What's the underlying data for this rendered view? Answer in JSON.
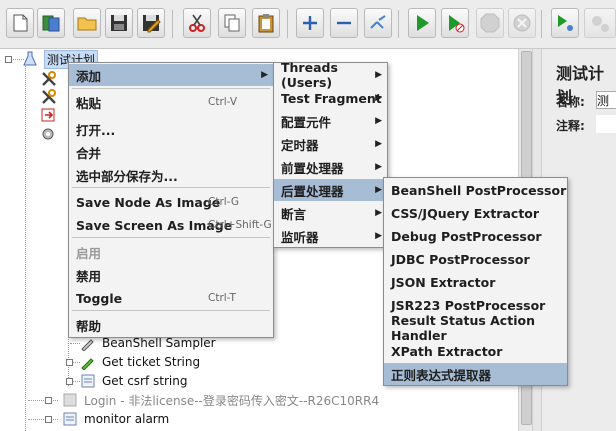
{
  "tree": {
    "root": "测试计划",
    "items": {
      "beanshell": "BeanShell Sampler",
      "get_ticket": "Get  ticket  String",
      "get_csrf": "Get csrf  string",
      "login": "Login - 非法license--登录密码传入密文--R26C10RR4",
      "monitor": "monitor alarm"
    }
  },
  "right_panel": {
    "title": "测试计划",
    "name_label": "名称:",
    "name_value": "测",
    "comment_label": "注释:"
  },
  "context_menu": {
    "items": [
      {
        "label": "添加",
        "shortcut": "",
        "submenu": true,
        "selected": true,
        "disabled": false
      },
      {
        "label": "粘贴",
        "shortcut": "Ctrl-V",
        "submenu": false,
        "selected": false,
        "disabled": false
      },
      {
        "label": "打开...",
        "shortcut": "",
        "submenu": false,
        "selected": false,
        "disabled": false
      },
      {
        "label": "合并",
        "shortcut": "",
        "submenu": false,
        "selected": false,
        "disabled": false
      },
      {
        "label": "选中部分保存为...",
        "shortcut": "",
        "submenu": false,
        "selected": false,
        "disabled": false
      },
      {
        "label": "Save Node As Image",
        "shortcut": "Ctrl-G",
        "submenu": false,
        "selected": false,
        "disabled": false
      },
      {
        "label": "Save Screen As Image",
        "shortcut": "Ctrl+Shift-G",
        "submenu": false,
        "selected": false,
        "disabled": false
      },
      {
        "label": "启用",
        "shortcut": "",
        "submenu": false,
        "selected": false,
        "disabled": true
      },
      {
        "label": "禁用",
        "shortcut": "",
        "submenu": false,
        "selected": false,
        "disabled": false
      },
      {
        "label": "Toggle",
        "shortcut": "Ctrl-T",
        "submenu": false,
        "selected": false,
        "disabled": false
      },
      {
        "label": "帮助",
        "shortcut": "",
        "submenu": false,
        "selected": false,
        "disabled": false
      }
    ]
  },
  "add_submenu": {
    "items": [
      {
        "label": "Threads (Users)",
        "selected": false
      },
      {
        "label": "Test Fragment",
        "selected": false
      },
      {
        "label": "配置元件",
        "selected": false
      },
      {
        "label": "定时器",
        "selected": false
      },
      {
        "label": "前置处理器",
        "selected": false
      },
      {
        "label": "后置处理器",
        "selected": true
      },
      {
        "label": "断言",
        "selected": false
      },
      {
        "label": "监听器",
        "selected": false
      }
    ]
  },
  "post_processor_submenu": {
    "items": [
      {
        "label": "BeanShell PostProcessor",
        "selected": false
      },
      {
        "label": "CSS/JQuery Extractor",
        "selected": false
      },
      {
        "label": "Debug PostProcessor",
        "selected": false
      },
      {
        "label": "JDBC PostProcessor",
        "selected": false
      },
      {
        "label": "JSON Extractor",
        "selected": false
      },
      {
        "label": "JSR223 PostProcessor",
        "selected": false
      },
      {
        "label": "Result Status Action Handler",
        "selected": false
      },
      {
        "label": "XPath Extractor",
        "selected": false
      },
      {
        "label": "正则表达式提取器",
        "selected": true
      }
    ]
  },
  "colors": {
    "menu_highlight": "#a7bdd5",
    "start_green": "#1f9a2a",
    "add_blue": "#2b5fb0"
  }
}
